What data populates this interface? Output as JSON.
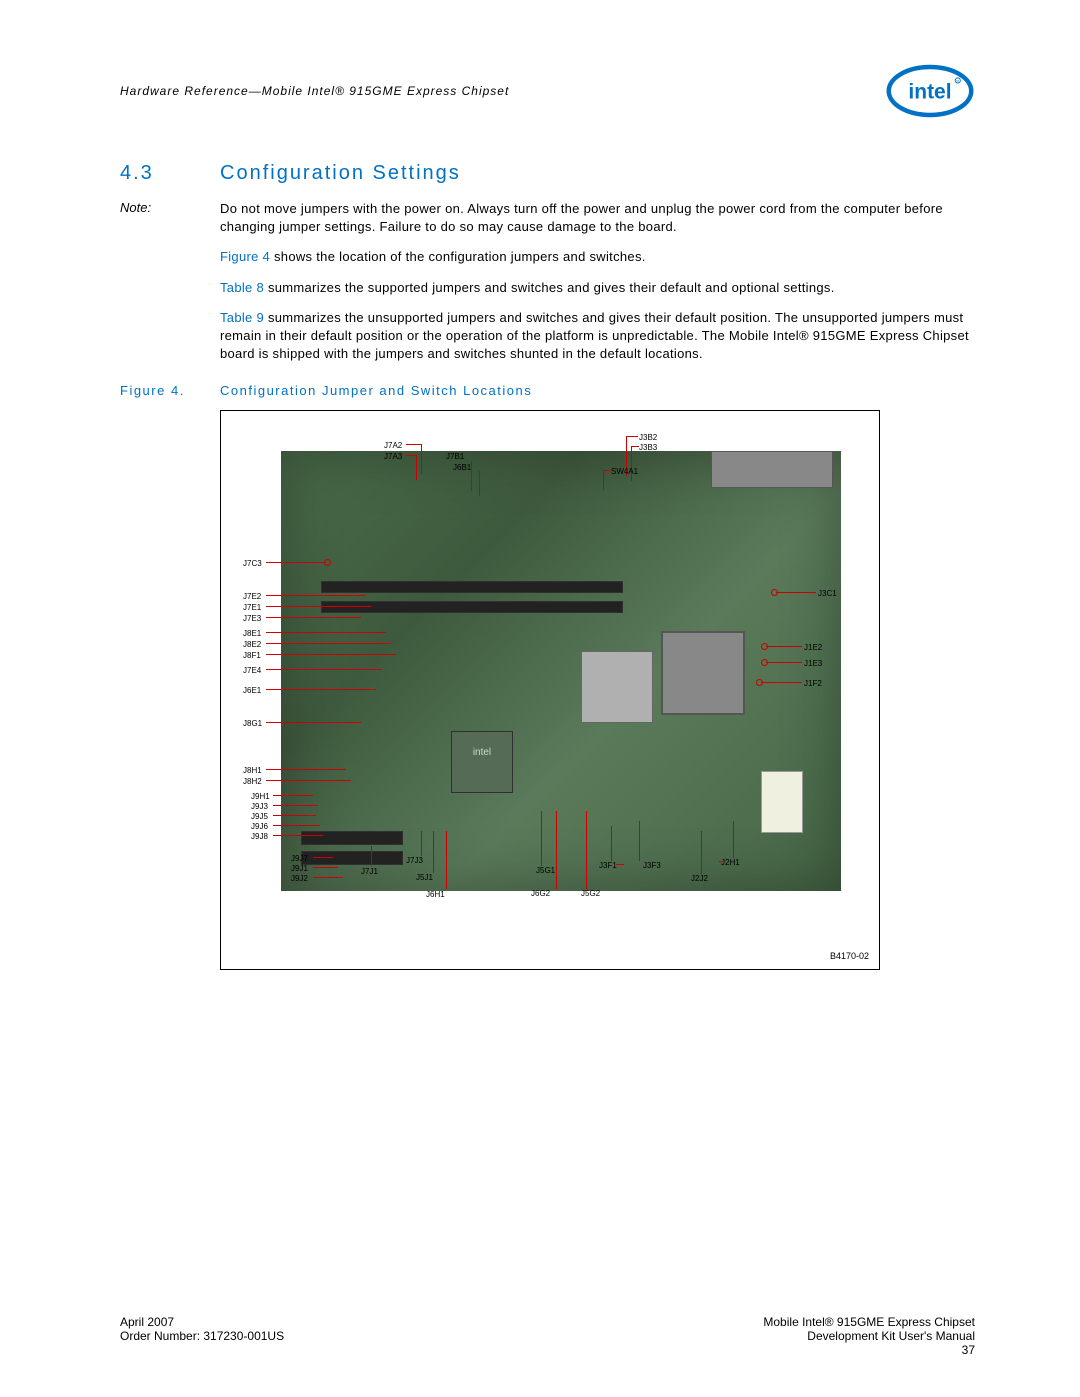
{
  "header": {
    "doc_title": "Hardware Reference—Mobile Intel® 915GME Express Chipset"
  },
  "section": {
    "number": "4.3",
    "title": "Configuration Settings"
  },
  "note": {
    "label": "Note:",
    "text": "Do not move jumpers with the power on. Always turn off the power and unplug the power cord from the computer before changing jumper settings. Failure to do so may cause damage to the board."
  },
  "paragraphs": {
    "p1_link": "Figure 4",
    "p1_rest": " shows the location of the configuration jumpers and switches.",
    "p2_link": "Table 8",
    "p2_rest": " summarizes the supported jumpers and switches and gives their default and optional settings.",
    "p3_link": "Table 9",
    "p3_rest": " summarizes the unsupported jumpers and switches and gives their default position. The unsupported jumpers must remain in their default position or the operation of the platform is unpredictable. The Mobile Intel® 915GME Express Chipset board is shipped with the jumpers and switches shunted in the default locations."
  },
  "figure": {
    "number": "Figure 4.",
    "title": "Configuration Jumper and Switch Locations",
    "ref": "B4170-02",
    "intel_chip_label": "intel"
  },
  "labels": {
    "top": [
      "J7A2",
      "J7A3",
      "J7B1",
      "J6B1",
      "J3B2",
      "J3B3",
      "SW4A1"
    ],
    "left": [
      "J7C3",
      "J7E2",
      "J7E1",
      "J7E3",
      "J8E1",
      "J8E2",
      "J8F1",
      "J7E4",
      "J6E1",
      "J8G1",
      "J8H1",
      "J8H2",
      "J9H1",
      "J9J3",
      "J9J5",
      "J9J6",
      "J9J8",
      "J9J7",
      "J9J1",
      "J9J2"
    ],
    "bottom": [
      "J7J1",
      "J7J3",
      "J5J1",
      "J6H1",
      "J5G1",
      "J6G2",
      "J5G2",
      "J3F1",
      "J3F3",
      "J2J2",
      "J2H1"
    ],
    "right": [
      "J3C1",
      "J1E2",
      "J1E3",
      "J1F2"
    ]
  },
  "footer": {
    "date": "April 2007",
    "order": "Order Number: 317230-001US",
    "product": "Mobile Intel® 915GME Express Chipset",
    "manual": "Development Kit User's Manual",
    "page": "37"
  }
}
